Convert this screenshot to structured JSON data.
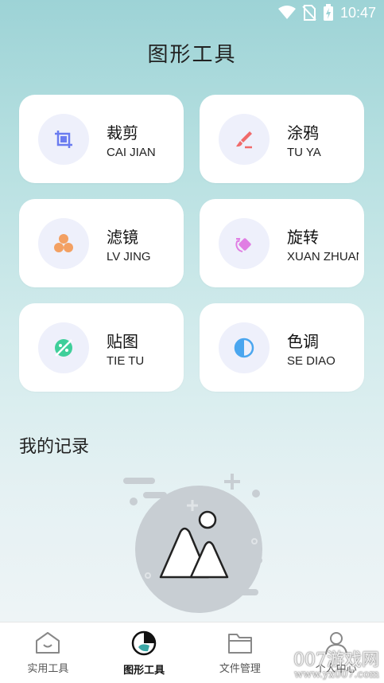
{
  "status_bar": {
    "time": "10:47",
    "icons": [
      "wifi-icon",
      "no-sim-icon",
      "battery-charging-icon"
    ]
  },
  "page_title": "图形工具",
  "tools": [
    {
      "zh": "裁剪",
      "en": "CAI JIAN",
      "icon": "crop-icon",
      "color": "#6b7cf0"
    },
    {
      "zh": "涂鸦",
      "en": "TU YA",
      "icon": "brush-icon",
      "color": "#f06a6a"
    },
    {
      "zh": "滤镜",
      "en": "LV JING",
      "icon": "filter-icon",
      "color": "#f3a062"
    },
    {
      "zh": "旋转",
      "en": "XUAN ZHUAN",
      "icon": "rotate-icon",
      "color": "#e07ee3"
    },
    {
      "zh": "贴图",
      "en": "TIE TU",
      "icon": "sticker-icon",
      "color": "#3fcf9a"
    },
    {
      "zh": "色调",
      "en": "SE DIAO",
      "icon": "tone-icon",
      "color": "#4aa6ef"
    }
  ],
  "records_title": "我的记录",
  "bottom_nav": [
    {
      "label": "实用工具",
      "icon": "toolbox-icon"
    },
    {
      "label": "图形工具",
      "icon": "graphics-tool-icon"
    },
    {
      "label": "文件管理",
      "icon": "folder-icon"
    },
    {
      "label": "个人中心",
      "icon": "person-icon"
    }
  ],
  "watermark": {
    "line1": "007游戏网",
    "line2": "www.yx007.com"
  }
}
